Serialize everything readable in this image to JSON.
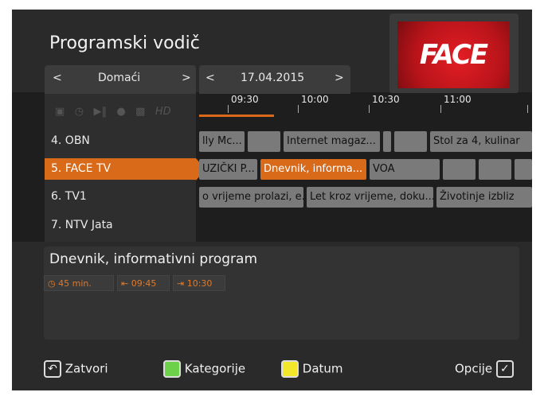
{
  "header": {
    "title": "Programski vodič"
  },
  "logo": {
    "text": "FACE"
  },
  "channel_selector": {
    "label": "Domaći",
    "prev": "<",
    "next": ">"
  },
  "date_selector": {
    "label": "17.04.2015",
    "prev": "<",
    "next": ">"
  },
  "filter_icons": [
    "lock-icon",
    "timer-icon",
    "play-pause-icon",
    "record-icon",
    "parental-lock-icon"
  ],
  "filter_hd": "HD",
  "channels": [
    {
      "label": "4. OBN"
    },
    {
      "label": "5. FACE TV"
    },
    {
      "label": "6. TV1"
    },
    {
      "label": "7. NTV Jata"
    }
  ],
  "times": [
    "09:30",
    "10:00",
    "10:30",
    "11:00"
  ],
  "schedule": {
    "row1": [
      "lly Mc...",
      "",
      "Internet magaz...",
      "",
      "",
      "Stol za 4, kulinar"
    ],
    "row2": [
      "UZIČKI P...",
      "Dnevnik, informa...",
      "VOA",
      "",
      "",
      ""
    ],
    "row3": [
      "o vrijeme prolazi, e...",
      "Let kroz vrijeme, doku...",
      "Životinje izbliz"
    ]
  },
  "info": {
    "title": "Dnevnik, informativni program",
    "duration": "45 min.",
    "start": "09:45",
    "end": "10:30"
  },
  "footer": {
    "close": "Zatvori",
    "categories": "Kategorije",
    "date": "Datum",
    "options": "Opcije"
  },
  "colors": {
    "accent": "#d86a1a",
    "green": "#6ed14a",
    "yellow": "#f2e72a"
  }
}
